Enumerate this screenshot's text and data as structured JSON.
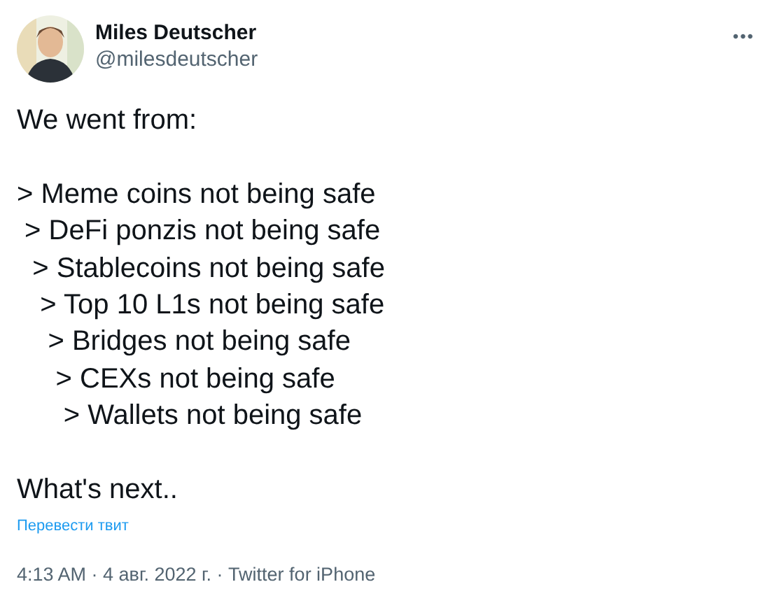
{
  "author": {
    "name": "Miles Deutscher",
    "handle": "@milesdeutscher"
  },
  "menu": "•••",
  "paragraphs": [
    [
      "We went from:"
    ],
    [
      "> Meme coins not being safe",
      " > DeFi ponzis not being safe",
      "  > Stablecoins not being safe",
      "   > Top 10 L1s not being safe",
      "    > Bridges not being safe",
      "     > CEXs not being safe",
      "      > Wallets not being safe"
    ],
    [
      "What's next.."
    ]
  ],
  "translate_link": "Перевести твит",
  "timestamp": "4:13 AM · 4 авг. 2022 г. · Twitter for iPhone"
}
